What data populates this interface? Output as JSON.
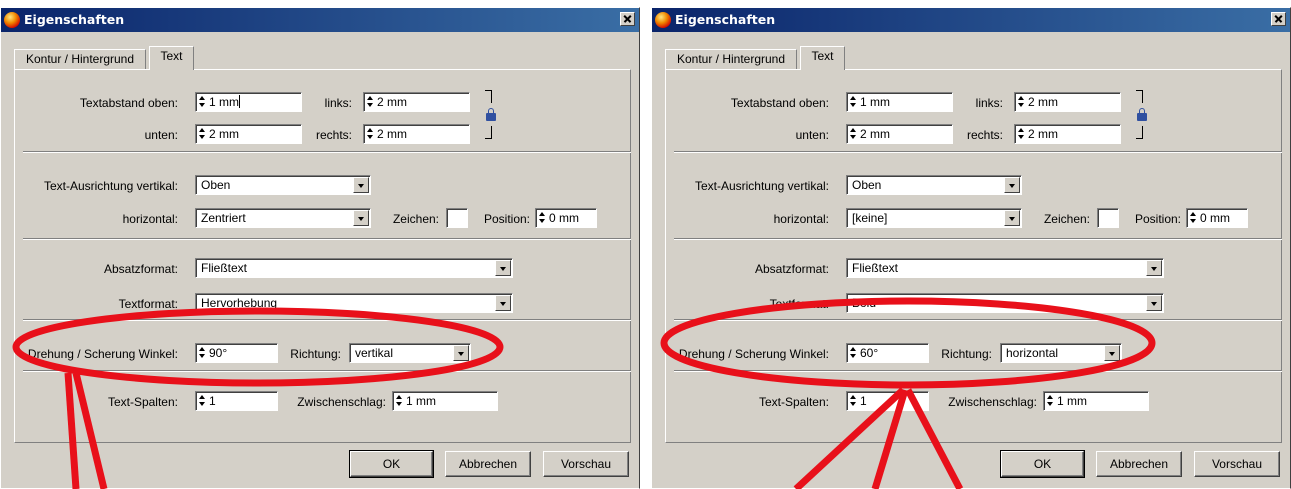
{
  "dialogs": [
    {
      "title": "Eigenschaften",
      "tabs": [
        "Kontur / Hintergrund",
        "Text"
      ],
      "labels": {
        "textabstand_oben": "Textabstand oben:",
        "links": "links:",
        "unten": "unten:",
        "rechts": "rechts:",
        "ausrichtung_vertikal": "Text-Ausrichtung vertikal:",
        "horizontal": "horizontal:",
        "zeichen": "Zeichen:",
        "position": "Position:",
        "absatzformat": "Absatzformat:",
        "textformat": "Textformat:",
        "drehung": "Drehung / Scherung Winkel:",
        "richtung": "Richtung:",
        "text_spalten": "Text-Spalten:",
        "zwischenschlag": "Zwischenschlag:"
      },
      "values": {
        "oben": "1 mm",
        "links": "2 mm",
        "unten": "2 mm",
        "rechts": "2 mm",
        "vertikal": "Oben",
        "horizontal": "Zentriert",
        "zeichen": "",
        "position": "0 mm",
        "absatzformat": "Fließtext",
        "textformat": "Hervorhebung",
        "winkel": "90°",
        "richtung": "vertikal",
        "spalten": "1",
        "zwischenschlag": "1 mm"
      },
      "buttons": {
        "ok": "OK",
        "abbrechen": "Abbrechen",
        "vorschau": "Vorschau"
      }
    },
    {
      "title": "Eigenschaften",
      "tabs": [
        "Kontur / Hintergrund",
        "Text"
      ],
      "labels": {
        "textabstand_oben": "Textabstand oben:",
        "links": "links:",
        "unten": "unten:",
        "rechts": "rechts:",
        "ausrichtung_vertikal": "Text-Ausrichtung vertikal:",
        "horizontal": "horizontal:",
        "zeichen": "Zeichen:",
        "position": "Position:",
        "absatzformat": "Absatzformat:",
        "textformat": "Textformat:",
        "drehung": "Drehung / Scherung Winkel:",
        "richtung": "Richtung:",
        "text_spalten": "Text-Spalten:",
        "zwischenschlag": "Zwischenschlag:"
      },
      "values": {
        "oben": "1 mm",
        "links": "2 mm",
        "unten": "2 mm",
        "rechts": "2 mm",
        "vertikal": "Oben",
        "horizontal": "[keine]",
        "zeichen": "",
        "position": "0 mm",
        "absatzformat": "Fließtext",
        "textformat": "Bold",
        "winkel": "60°",
        "richtung": "horizontal",
        "spalten": "1",
        "zwischenschlag": "1 mm"
      },
      "buttons": {
        "ok": "OK",
        "abbrechen": "Abbrechen",
        "vorschau": "Vorschau"
      }
    }
  ],
  "colors": {
    "titlebar": "#0a246a",
    "dialog_bg": "#d4d0c8",
    "annotation": "#e8101a"
  }
}
